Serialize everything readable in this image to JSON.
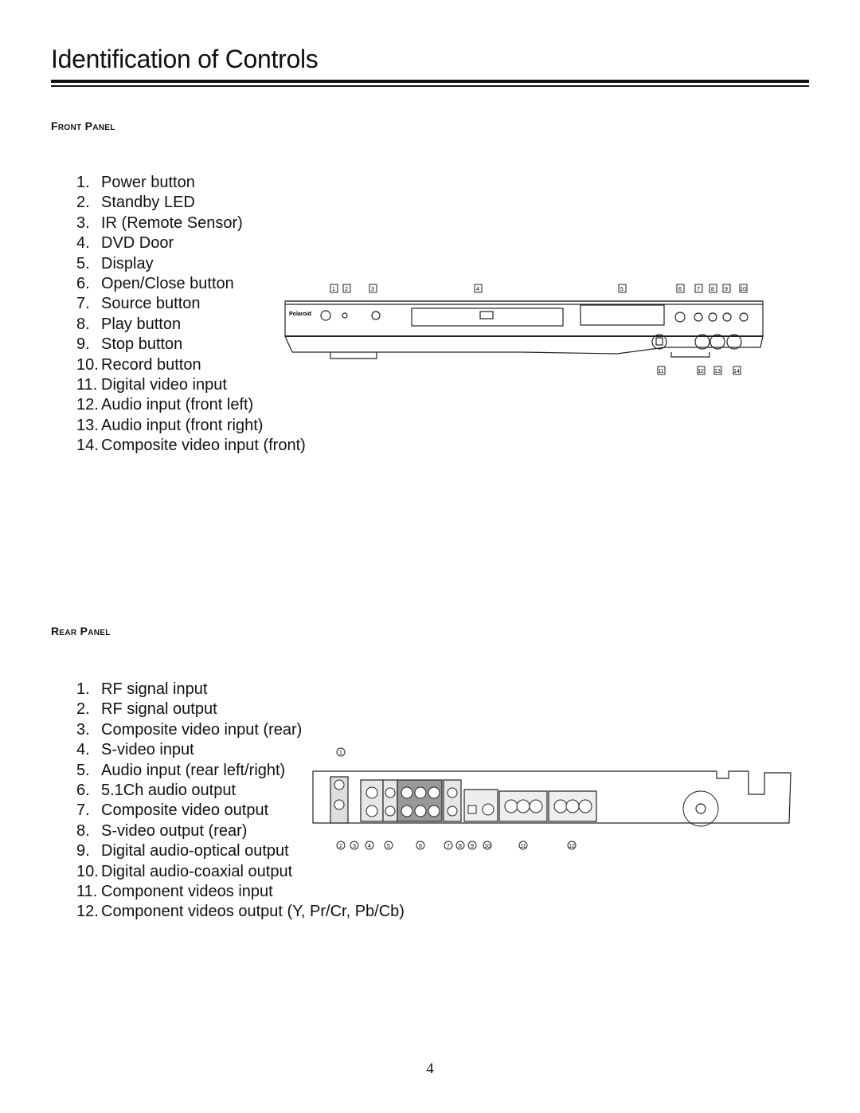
{
  "page": {
    "title": "Identification of Controls",
    "page_number": "4"
  },
  "front_panel": {
    "heading": "Front Panel",
    "items": [
      {
        "num": "1.",
        "label": "Power button"
      },
      {
        "num": "2.",
        "label": "Standby LED"
      },
      {
        "num": "3.",
        "label": "IR (Remote Sensor)"
      },
      {
        "num": "4.",
        "label": "DVD Door"
      },
      {
        "num": "5.",
        "label": "Display"
      },
      {
        "num": "6.",
        "label": "Open/Close button"
      },
      {
        "num": "7.",
        "label": "Source button"
      },
      {
        "num": "8.",
        "label": "Play button"
      },
      {
        "num": "9.",
        "label": "Stop button"
      },
      {
        "num": "10.",
        "label": "Record button"
      },
      {
        "num": "11.",
        "label": "Digital video input"
      },
      {
        "num": "12.",
        "label": "Audio input (front left)"
      },
      {
        "num": "13.",
        "label": "Audio input (front right)"
      },
      {
        "num": "14.",
        "label": "Composite video input (front)"
      }
    ],
    "diagram": {
      "brand_logo": "Polaroid",
      "callouts": [
        "1",
        "2",
        "3",
        "4",
        "5",
        "6",
        "7",
        "8",
        "9",
        "10",
        "11",
        "12",
        "13",
        "14"
      ]
    }
  },
  "rear_panel": {
    "heading": "Rear Panel",
    "items": [
      {
        "num": "1.",
        "label": "RF signal input"
      },
      {
        "num": "2.",
        "label": "RF signal output"
      },
      {
        "num": "3.",
        "label": "Composite video input (rear)"
      },
      {
        "num": "4.",
        "label": "S-video input"
      },
      {
        "num": "5.",
        "label": "Audio input (rear left/right)"
      },
      {
        "num": "6.",
        "label": "5.1Ch audio output"
      },
      {
        "num": "7.",
        "label": "Composite video output"
      },
      {
        "num": "8.",
        "label": "S-video output (rear)"
      },
      {
        "num": "9.",
        "label": "Digital audio-optical output"
      },
      {
        "num": "10.",
        "label": "Digital audio-coaxial output"
      },
      {
        "num": "11.",
        "label": "Component videos input"
      },
      {
        "num": "12.",
        "label": "Component videos output (Y, Pr/Cr, Pb/Cb)"
      }
    ],
    "diagram": {
      "callouts": [
        "1",
        "2",
        "3",
        "4",
        "5",
        "6",
        "7",
        "8",
        "9",
        "10",
        "11",
        "12"
      ]
    }
  }
}
